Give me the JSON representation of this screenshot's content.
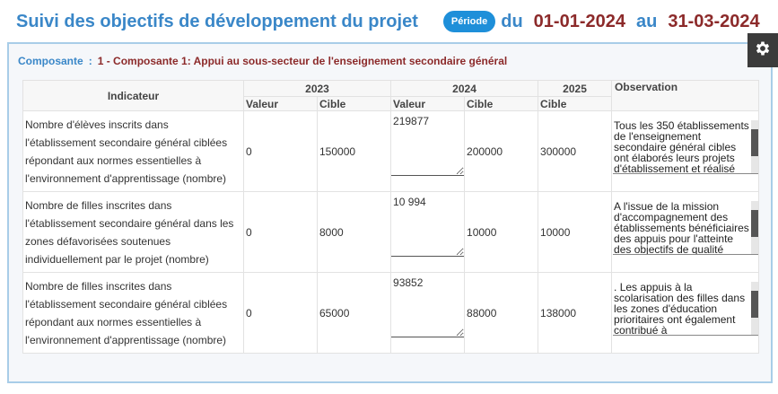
{
  "header": {
    "title": "Suivi des objectifs de développement du projet",
    "periode_label": "Période",
    "du_label": "du",
    "date_start": "01-01-2024",
    "au_label": "au",
    "date_end": "31-03-2024"
  },
  "icons": {
    "settings": "gear-icon"
  },
  "composante": {
    "label": "Composante",
    "separator": ":",
    "value": "1 - Composante 1: Appui au sous-secteur de l'enseignement secondaire général"
  },
  "table": {
    "header_indicateur": "Indicateur",
    "years": [
      "2023",
      "2024",
      "2025"
    ],
    "header_observation": "Observation",
    "sub_valeur": "Valeur",
    "sub_cible": "Cible",
    "rows": [
      {
        "indicator": "Nombre d'élèves inscrits dans l'établissement secondaire général ciblées répondant aux normes essentielles à l'environnement d'apprentissage (nombre)",
        "valeur_2023": "0",
        "cible_2023": "150000",
        "valeur_2024": "219877",
        "cible_2024": "200000",
        "cible_2025": "300000",
        "observation": "Tous les 350 établissements de l'enseignement secondaire général cibles ont élaborés leurs projets d'établissement et réalisé"
      },
      {
        "indicator": "Nombre de filles inscrites dans l'établissement secondaire général dans les zones défavorisées soutenues individuellement par le projet (nombre)",
        "valeur_2023": "0",
        "cible_2023": "8000",
        "valeur_2024": "10 994",
        "cible_2024": "10000",
        "cible_2025": "10000",
        "observation": "A l'issue de la mission d'accompagnement des établissements bénéficiaires des appuis pour l'atteinte des objectifs de qualité"
      },
      {
        "indicator": "Nombre de filles inscrites dans l'établissement secondaire général ciblées répondant aux normes essentielles à l'environnement d'apprentissage (nombre)",
        "valeur_2023": "0",
        "cible_2023": "65000",
        "valeur_2024": "93852",
        "cible_2024": "88000",
        "cible_2025": "138000",
        "observation": ". Les appuis à la scolarisation des filles dans les zones d'éducation prioritaires ont également contribué à"
      }
    ]
  }
}
